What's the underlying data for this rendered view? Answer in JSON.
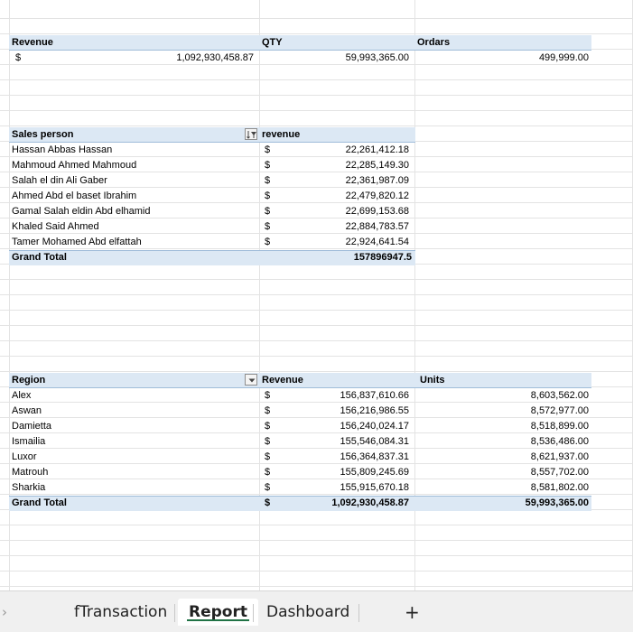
{
  "summary": {
    "headers": [
      "Revenue",
      "QTY",
      "Ordars"
    ],
    "currency": "$",
    "revenue": "1,092,930,458.87",
    "qty": "59,993,365.00",
    "orders": "499,999.00"
  },
  "sales_pivot": {
    "header_person": "Sales person",
    "header_revenue": "revenue",
    "rows": [
      {
        "name": "Hassan Abbas Hassan",
        "currency": "$",
        "value": "22,261,412.18"
      },
      {
        "name": "Mahmoud Ahmed Mahmoud",
        "currency": "$",
        "value": "22,285,149.30"
      },
      {
        "name": "Salah el din Ali Gaber",
        "currency": "$",
        "value": "22,361,987.09"
      },
      {
        "name": "Ahmed Abd el baset Ibrahim",
        "currency": "$",
        "value": "22,479,820.12"
      },
      {
        "name": "Gamal Salah eldin Abd elhamid",
        "currency": "$",
        "value": "22,699,153.68"
      },
      {
        "name": "Khaled Said Ahmed",
        "currency": "$",
        "value": "22,884,783.57"
      },
      {
        "name": "Tamer Mohamed Abd elfattah",
        "currency": "$",
        "value": "22,924,641.54"
      }
    ],
    "grand_total_label": "Grand Total",
    "grand_total_value": "157896947.5"
  },
  "region_pivot": {
    "header_region": "Region",
    "header_revenue": "Revenue",
    "header_units": "Units",
    "rows": [
      {
        "region": "Alex",
        "currency": "$",
        "revenue": "156,837,610.66",
        "units": "8,603,562.00"
      },
      {
        "region": "Aswan",
        "currency": "$",
        "revenue": "156,216,986.55",
        "units": "8,572,977.00"
      },
      {
        "region": "Damietta",
        "currency": "$",
        "revenue": "156,240,024.17",
        "units": "8,518,899.00"
      },
      {
        "region": "Ismailia",
        "currency": "$",
        "revenue": "155,546,084.31",
        "units": "8,536,486.00"
      },
      {
        "region": "Luxor",
        "currency": "$",
        "revenue": "156,364,837.31",
        "units": "8,621,937.00"
      },
      {
        "region": "Matrouh",
        "currency": "$",
        "revenue": "155,809,245.69",
        "units": "8,557,702.00"
      },
      {
        "region": "Sharkia",
        "currency": "$",
        "revenue": "155,915,670.18",
        "units": "8,581,802.00"
      }
    ],
    "grand_total_label": "Grand Total",
    "grand_total_currency": "$",
    "grand_total_revenue": "1,092,930,458.87",
    "grand_total_units": "59,993,365.00"
  },
  "sheet_tabs": {
    "scroll_left": "›",
    "tabs": [
      "fTransaction",
      "Report",
      "Dashboard"
    ],
    "active": "Report",
    "add": "+"
  },
  "colors": {
    "header_fill": "#dce8f4",
    "gridline": "#e3e3e3",
    "active_tab_underline": "#217346"
  }
}
